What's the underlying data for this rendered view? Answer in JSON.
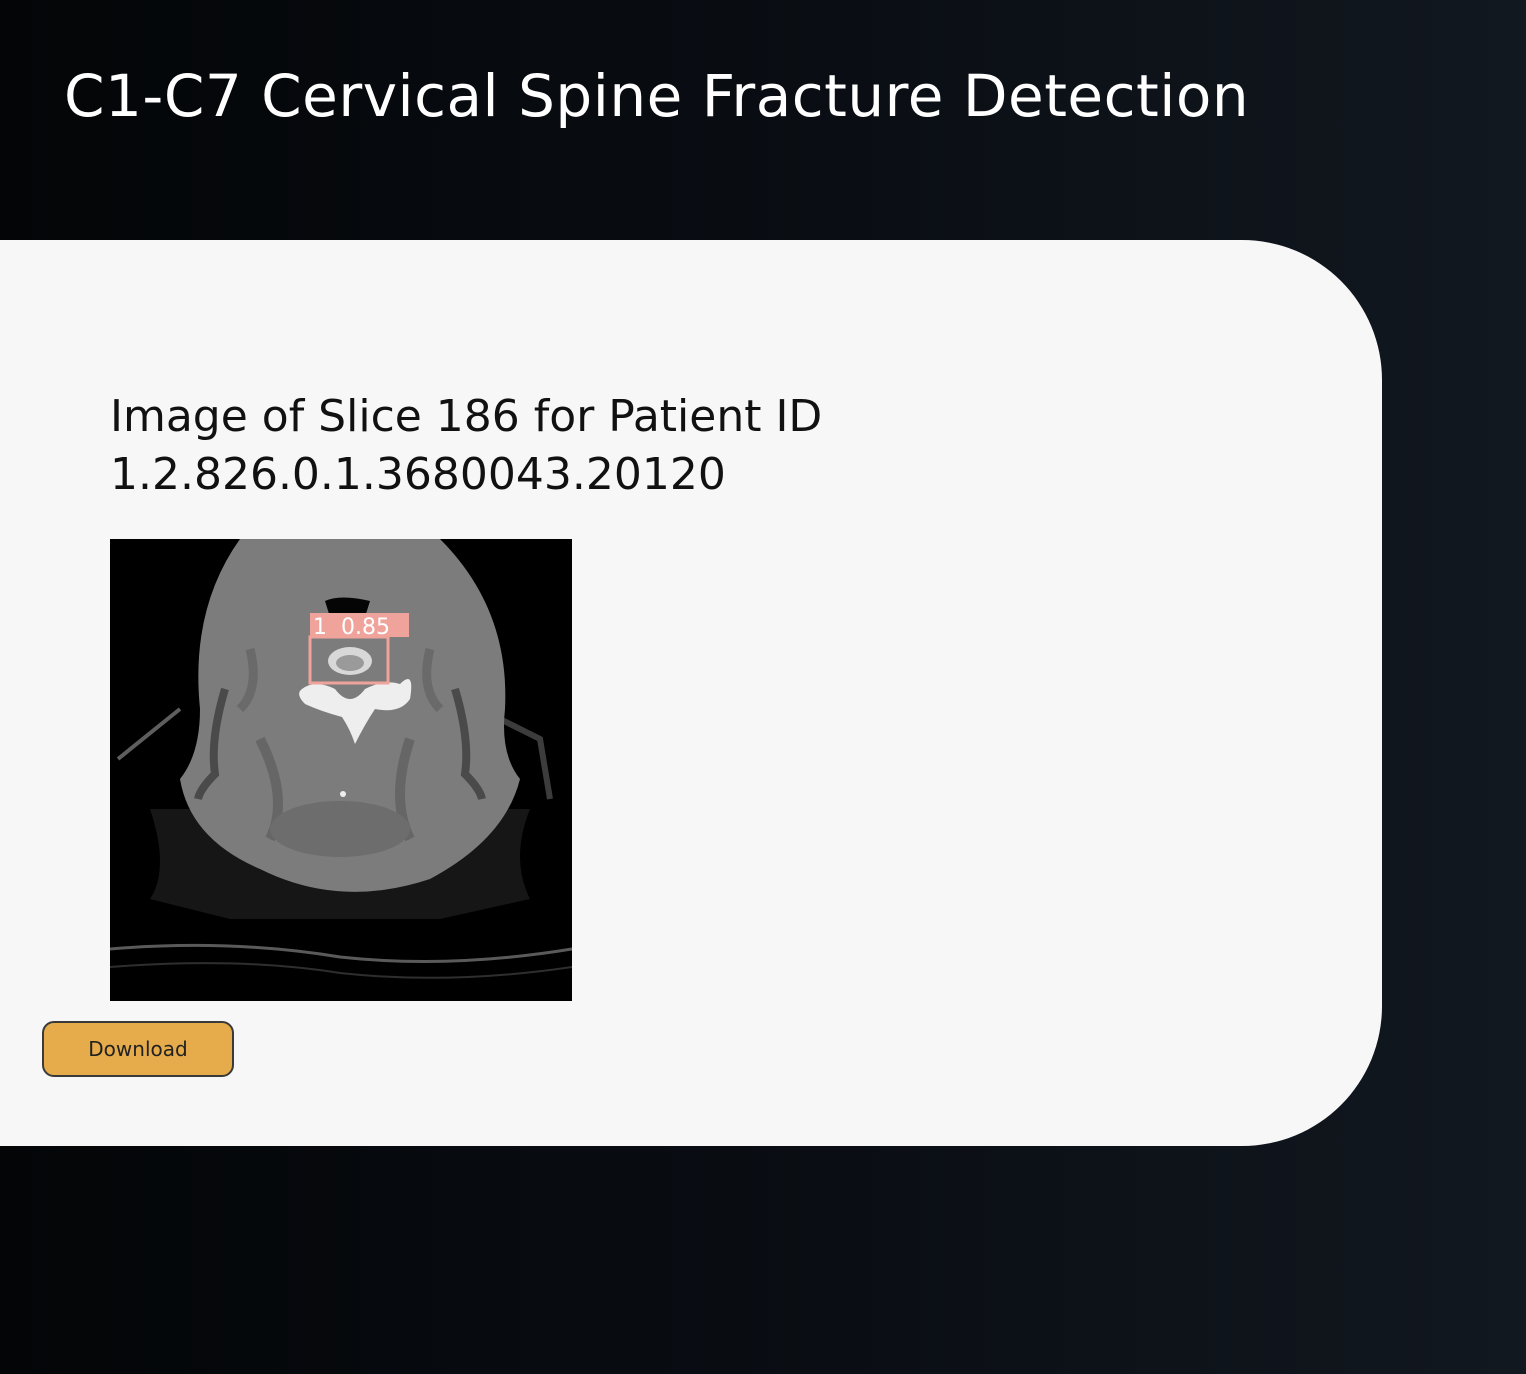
{
  "header": {
    "title": "C1-C7 Cervical Spine Fracture Detection"
  },
  "result": {
    "heading_line1": "Image of Slice 186 for Patient ID",
    "heading_line2": "1.2.826.0.1.3680043.20120",
    "detection": {
      "label": "1  0.85",
      "class": "1",
      "confidence": 0.85,
      "box_color": "#f0a39b"
    },
    "download_label": "Download"
  },
  "colors": {
    "background": "#05080c",
    "panel": "#f7f7f8",
    "accent": "#e6ab4a"
  }
}
